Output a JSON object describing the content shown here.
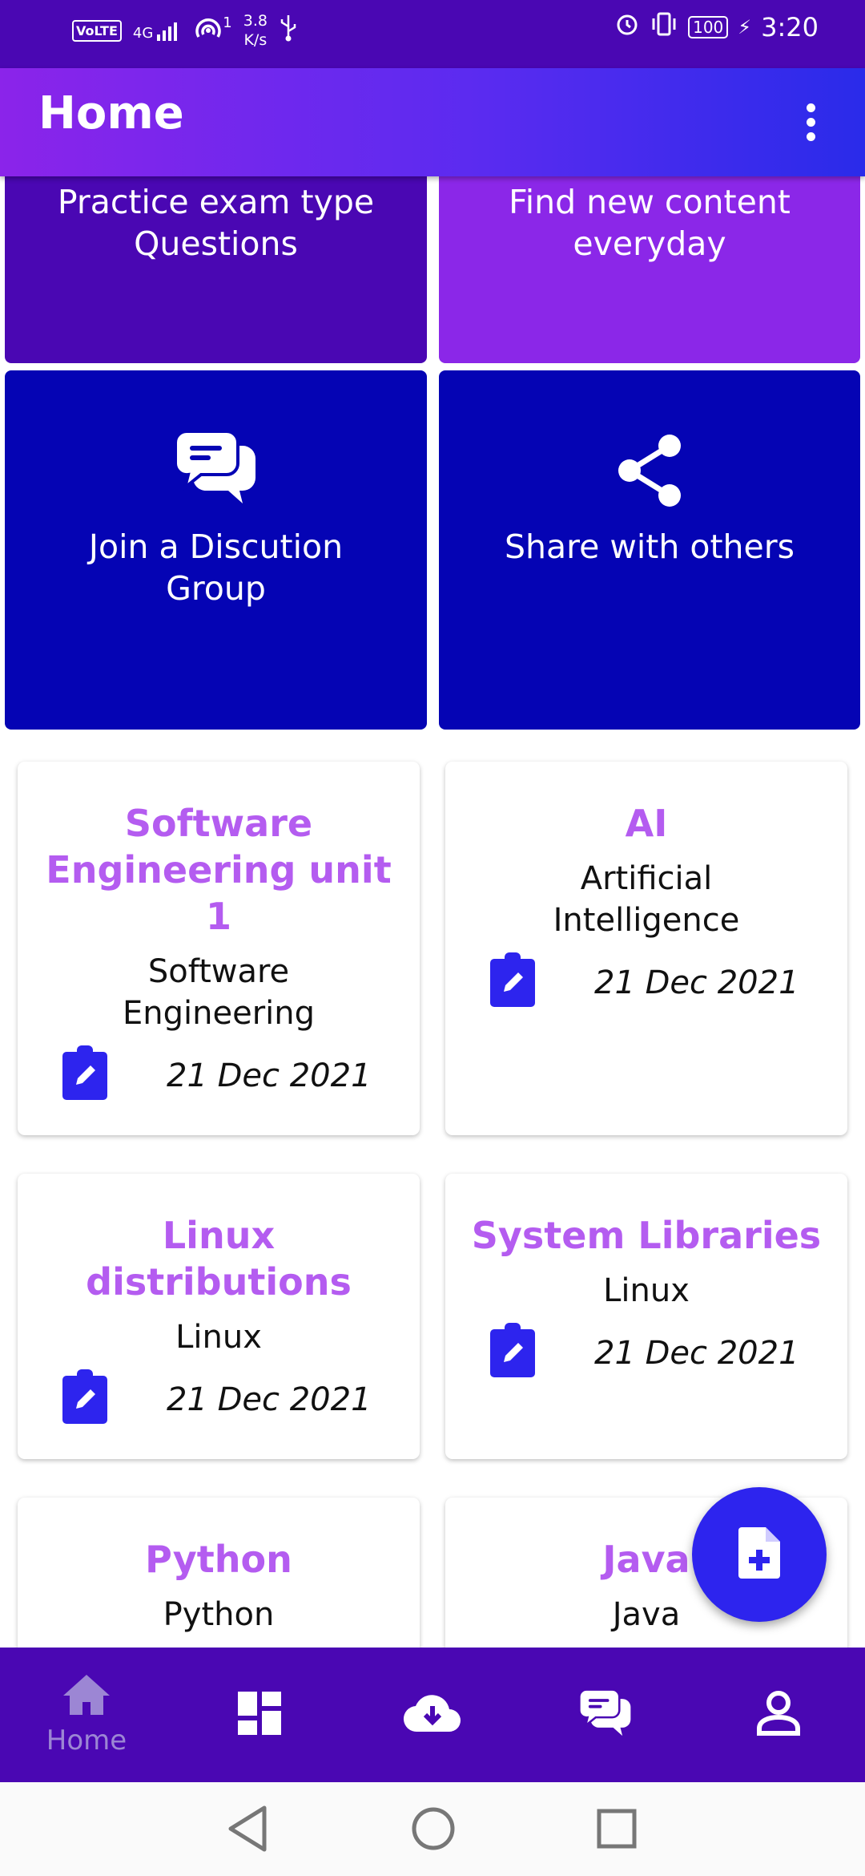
{
  "status_bar": {
    "volte": "VoLTE",
    "network": "4G",
    "hotspot_count": "1",
    "net_speed_value": "3.8",
    "net_speed_unit": "K/s",
    "battery": "100",
    "time": "3:20"
  },
  "app_bar": {
    "title": "Home"
  },
  "feature_tiles": [
    {
      "label": "Practice exam type Questions",
      "color": "#4a07b3"
    },
    {
      "label": "Find new content everyday",
      "color": "#8b27e8"
    },
    {
      "label": "Join a Discution Group",
      "color": "#0504b4",
      "icon": "chat-bubbles-icon"
    },
    {
      "label": "Share with others",
      "color": "#0504b4",
      "icon": "share-icon"
    }
  ],
  "notes": [
    {
      "title": "Software Engineering unit 1",
      "subject": "Software Engineering",
      "date": "21 Dec 2021"
    },
    {
      "title": "AI",
      "subject": "Artificial Intelligence",
      "date": "21 Dec 2021"
    },
    {
      "title": "Linux distributions",
      "subject": "Linux",
      "date": "21 Dec 2021"
    },
    {
      "title": "System Libraries",
      "subject": "Linux",
      "date": "21 Dec 2021"
    },
    {
      "title": "Python",
      "subject": "Python",
      "date": ""
    },
    {
      "title": "Java",
      "subject": "Java",
      "date": ""
    }
  ],
  "fab": {
    "icon": "add-document-icon"
  },
  "bottom_nav": {
    "items": [
      {
        "label": "Home",
        "icon": "home-icon",
        "active": true
      },
      {
        "label": "",
        "icon": "dashboard-icon"
      },
      {
        "label": "",
        "icon": "cloud-download-icon"
      },
      {
        "label": "",
        "icon": "chat-icon"
      },
      {
        "label": "",
        "icon": "profile-icon"
      }
    ]
  },
  "colors": {
    "primary": "#4a07b3",
    "accent": "#2d24ee",
    "card_title": "#b45cf0"
  }
}
